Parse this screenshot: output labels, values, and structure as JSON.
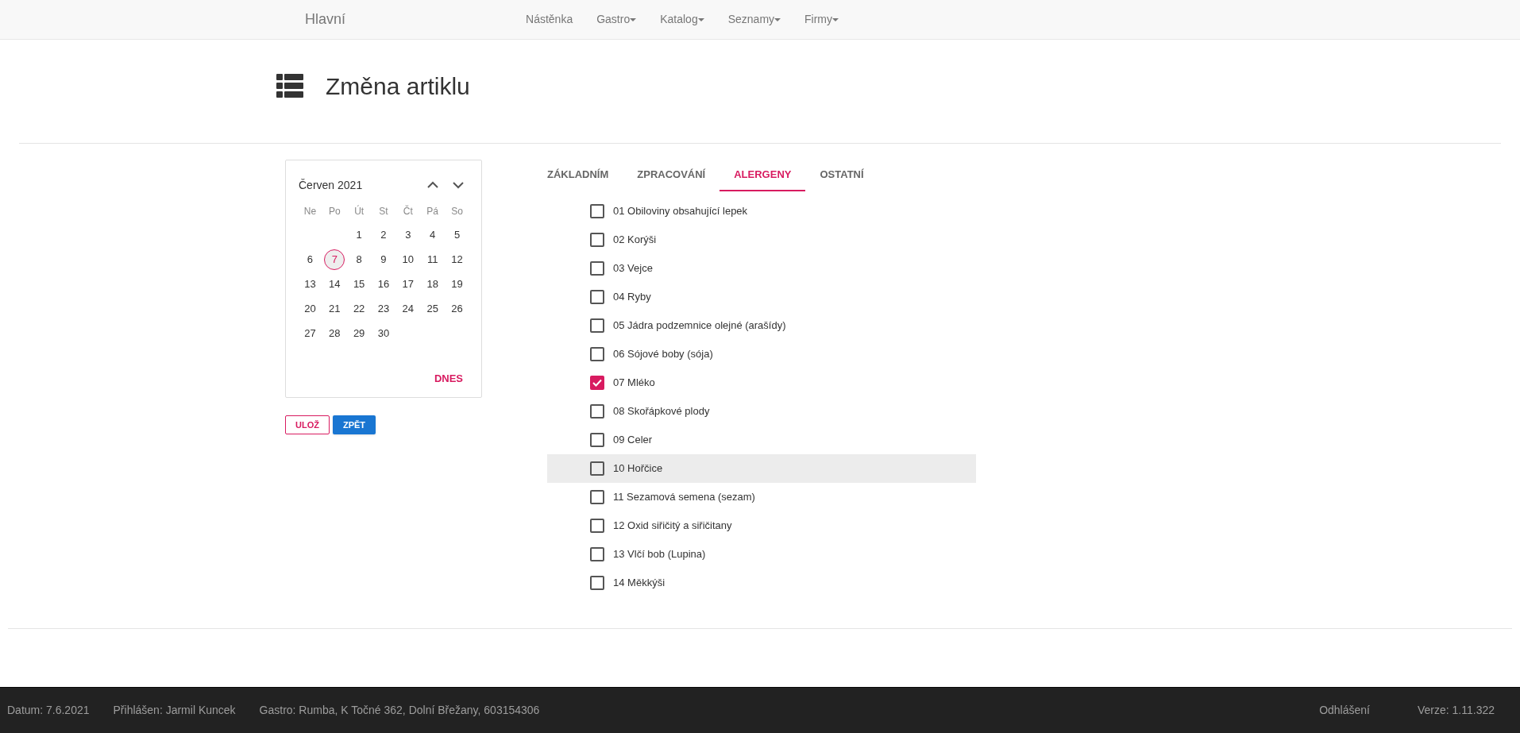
{
  "navbar": {
    "brand": "Hlavní",
    "items": [
      {
        "label": "Nástěnka",
        "dropdown": false
      },
      {
        "label": "Gastro",
        "dropdown": true
      },
      {
        "label": "Katalog",
        "dropdown": true
      },
      {
        "label": "Seznamy",
        "dropdown": true
      },
      {
        "label": "Firmy",
        "dropdown": true
      }
    ]
  },
  "page": {
    "title": "Změna artiklu"
  },
  "calendar": {
    "month": "Červen 2021",
    "weekdays": [
      "Ne",
      "Po",
      "Út",
      "St",
      "Čt",
      "Pá",
      "So"
    ],
    "weeks": [
      [
        {
          "day": "1",
          "selected": false
        },
        {
          "day": "2",
          "selected": false
        },
        {
          "day": "3",
          "selected": false
        },
        {
          "day": "4",
          "selected": false
        },
        {
          "day": "5",
          "selected": false
        }
      ],
      [
        {
          "day": "6",
          "selected": false
        },
        {
          "day": "7",
          "selected": true
        },
        {
          "day": "8",
          "selected": false
        },
        {
          "day": "9",
          "selected": false
        },
        {
          "day": "10",
          "selected": false
        },
        {
          "day": "11",
          "selected": false
        },
        {
          "day": "12",
          "selected": false
        }
      ],
      [
        {
          "day": "13",
          "selected": false
        },
        {
          "day": "14",
          "selected": false
        },
        {
          "day": "15",
          "selected": false
        },
        {
          "day": "16",
          "selected": false
        },
        {
          "day": "17",
          "selected": false
        },
        {
          "day": "18",
          "selected": false
        },
        {
          "day": "19",
          "selected": false
        }
      ],
      [
        {
          "day": "20",
          "selected": false
        },
        {
          "day": "21",
          "selected": false
        },
        {
          "day": "22",
          "selected": false
        },
        {
          "day": "23",
          "selected": false
        },
        {
          "day": "24",
          "selected": false
        },
        {
          "day": "25",
          "selected": false
        },
        {
          "day": "26",
          "selected": false
        }
      ],
      [
        {
          "day": "27",
          "selected": false
        },
        {
          "day": "28",
          "selected": false
        },
        {
          "day": "29",
          "selected": false
        },
        {
          "day": "30",
          "selected": false
        }
      ]
    ],
    "today_button": "DNES"
  },
  "buttons": [
    {
      "label": "ULOŽ",
      "kind": "outline"
    },
    {
      "label": "ZPĚT",
      "kind": "primary"
    }
  ],
  "tabs": [
    {
      "label": "ZÁKLADNÍM",
      "selected": false
    },
    {
      "label": "ZPRACOVÁNÍ",
      "selected": false
    },
    {
      "label": "ALERGENY",
      "selected": true
    },
    {
      "label": "OSTATNÍ",
      "selected": false
    }
  ],
  "allergens": [
    {
      "label": "01 Obiloviny obsahující lepek",
      "checked": false,
      "hovered": false
    },
    {
      "label": "02 Korýši",
      "checked": false,
      "hovered": false
    },
    {
      "label": "03 Vejce",
      "checked": false,
      "hovered": false
    },
    {
      "label": "04 Ryby",
      "checked": false,
      "hovered": false
    },
    {
      "label": "05 Jádra podzemnice olejné (arašídy)",
      "checked": false,
      "hovered": false
    },
    {
      "label": "06 Sójové boby (sója)",
      "checked": false,
      "hovered": false
    },
    {
      "label": "07 Mléko",
      "checked": true,
      "hovered": false
    },
    {
      "label": "08 Skořápkové plody",
      "checked": false,
      "hovered": false
    },
    {
      "label": "09 Celer",
      "checked": false,
      "hovered": false
    },
    {
      "label": "10 Hořčice",
      "checked": false,
      "hovered": true
    },
    {
      "label": "11 Sezamová semena (sezam)",
      "checked": false,
      "hovered": false
    },
    {
      "label": "12 Oxid siřičitý a siřičitany",
      "checked": false,
      "hovered": false
    },
    {
      "label": "13 Vlčí bob (Lupina)",
      "checked": false,
      "hovered": false
    },
    {
      "label": "14 Měkkýši",
      "checked": false,
      "hovered": false
    }
  ],
  "status_bar": {
    "left": [
      "Datum: 7.6.2021",
      "Přihlášen: Jarmil Kuncek",
      "Gastro: Rumba, K Točné 362, Dolní Břežany, 603154306"
    ],
    "logout": "Odhlášení",
    "version": "Verze: 1.11.322"
  }
}
